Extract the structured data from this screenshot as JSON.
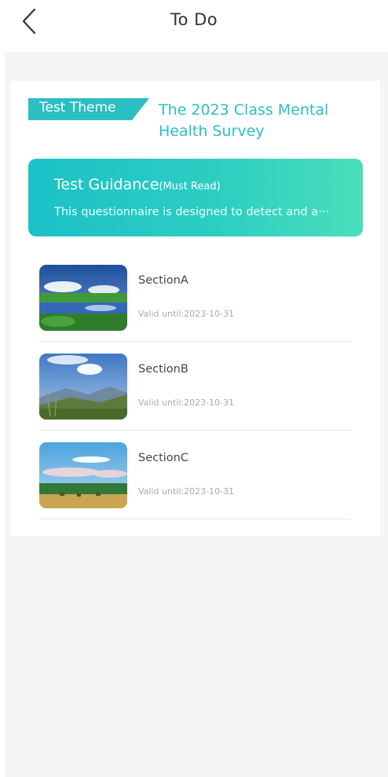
{
  "header": {
    "title": "To Do",
    "back_icon": "chevron-left-icon"
  },
  "theme": {
    "tag_label": "Test Theme",
    "title": "The 2023 Class Mental Health Survey"
  },
  "guidance": {
    "title": "Test Guidance",
    "subtitle": "(Must Read)",
    "text": "This questionnaire is designed to detect and a···"
  },
  "sections": [
    {
      "name": "SectionA",
      "valid": "Valid until:2023-10-31",
      "image": "lake-landscape"
    },
    {
      "name": "SectionB",
      "valid": "Valid until:2023-10-31",
      "image": "mountain-landscape"
    },
    {
      "name": "SectionC",
      "valid": "Valid until:2023-10-31",
      "image": "savanna-landscape"
    }
  ],
  "colors": {
    "accent": "#2bbfc4",
    "gradient_start": "#1bc1c7",
    "gradient_end": "#49dfbb",
    "background": "#f5f5f5"
  }
}
